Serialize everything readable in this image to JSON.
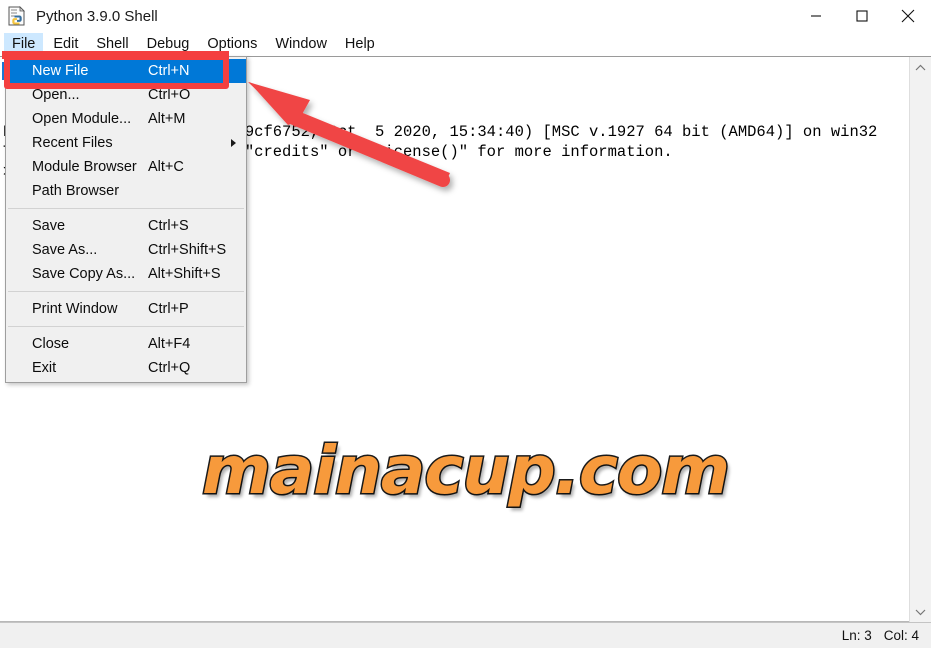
{
  "window": {
    "title": "Python 3.9.0 Shell",
    "icon": "idle-python-icon",
    "controls": {
      "minimize": "minimize-icon",
      "maximize": "maximize-icon",
      "close": "close-icon"
    }
  },
  "menubar": {
    "items": [
      {
        "label": "File",
        "active": true
      },
      {
        "label": "Edit",
        "active": false
      },
      {
        "label": "Shell",
        "active": false
      },
      {
        "label": "Debug",
        "active": false
      },
      {
        "label": "Options",
        "active": false
      },
      {
        "label": "Window",
        "active": false
      },
      {
        "label": "Help",
        "active": false
      }
    ]
  },
  "file_menu": {
    "items": [
      {
        "label": "New File",
        "accel": "Ctrl+N",
        "selected": true,
        "submenu": false
      },
      {
        "label": "Open...",
        "accel": "Ctrl+O",
        "selected": false,
        "submenu": false
      },
      {
        "label": "Open Module...",
        "accel": "Alt+M",
        "selected": false,
        "submenu": false
      },
      {
        "label": "Recent Files",
        "accel": "",
        "selected": false,
        "submenu": true
      },
      {
        "label": "Module Browser",
        "accel": "Alt+C",
        "selected": false,
        "submenu": false
      },
      {
        "label": "Path Browser",
        "accel": "",
        "selected": false,
        "submenu": false
      },
      {
        "separator": true
      },
      {
        "label": "Save",
        "accel": "Ctrl+S",
        "selected": false,
        "submenu": false
      },
      {
        "label": "Save As...",
        "accel": "Ctrl+Shift+S",
        "selected": false,
        "submenu": false
      },
      {
        "label": "Save Copy As...",
        "accel": "Alt+Shift+S",
        "selected": false,
        "submenu": false
      },
      {
        "separator": true
      },
      {
        "label": "Print Window",
        "accel": "Ctrl+P",
        "selected": false,
        "submenu": false
      },
      {
        "separator": true
      },
      {
        "label": "Close",
        "accel": "Alt+F4",
        "selected": false,
        "submenu": false
      },
      {
        "label": "Exit",
        "accel": "Ctrl+Q",
        "selected": false,
        "submenu": false
      }
    ]
  },
  "shell": {
    "lines": [
      "Python 3.9.0 (tags/v3.9.0:9cf6752, Oct  5 2020, 15:34:40) [MSC v.1927 64 bit (AMD64)] on win32",
      "Type \"help\", \"copyright\", \"credits\" or \"license()\" for more information.",
      ">>> "
    ],
    "scrollbar": {
      "up_arrow": "chevron-up-icon",
      "down_arrow": "chevron-down-icon"
    }
  },
  "statusbar": {
    "line": "Ln: 3",
    "column": "Col: 4"
  },
  "annotations": {
    "highlight_color": "#f43f3f",
    "arrow_color": "#f04545",
    "arrow_label": "pointer-to-new-file"
  },
  "watermark": {
    "text": "mainacup.com",
    "fill_color": "#f79a3c",
    "stroke_color": "#1a1a1a"
  }
}
